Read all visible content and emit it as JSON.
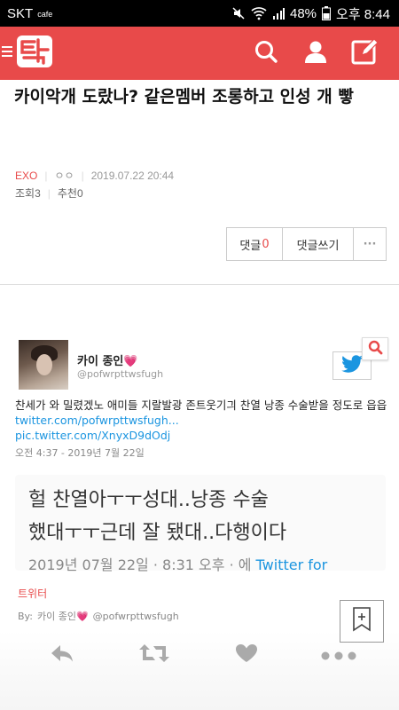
{
  "status_bar": {
    "carrier": "SKT",
    "carrier_sub": "cafe",
    "battery": "48%",
    "time": "오후 8:44"
  },
  "app_bar": {
    "logo_text": "판",
    "icons": [
      "menu-icon",
      "search-icon",
      "user-icon",
      "write-icon"
    ],
    "brand_color": "#e84a4a"
  },
  "post": {
    "title": "카이악개 도랐나? 같은멤버 조롱하고 인성 개 빻",
    "category": "EXO",
    "author": "ㅇㅇ",
    "date": "2019.07.22 20:44",
    "views_label": "조회3",
    "likes_label": "추천0"
  },
  "buttons": {
    "comments_label": "댓글",
    "comments_count": "0",
    "write_comment_label": "댓글쓰기",
    "more_label": "···"
  },
  "tweet": {
    "user_name": "카이 종인💗",
    "user_handle": "@pofwrpttwsfugh",
    "text": "찬세가 와 밀렸겠노 애미들 지랄발광 존트웃기긔 찬열 낭종 수술받을 정도로 읍읍 ",
    "link1": "twitter.com/pofwrpttwsfugh...",
    "link2": "pic.twitter.com/XnyxD9dOdj",
    "time": "오전 4:37 - 2019년 7월 22일",
    "quote_line1": "헐 찬열아ㅜㅜ성대..낭종 수술",
    "quote_line2": "했대ㅜㅜ근데 잘 됐대..다행이다",
    "quote_footer_date": "2019년 07월 22일 · 8:31 오후 · 에 ",
    "quote_footer_source": "Twitter for",
    "source_label": "트위터",
    "by_label": "By:",
    "by_name": "카이 종인💗",
    "by_handle": "@pofwrpttwsfugh"
  },
  "actions": {
    "icons": [
      "reply-icon",
      "retweet-icon",
      "heart-icon",
      "more-icon"
    ],
    "accent_color": "#1b95e0"
  }
}
